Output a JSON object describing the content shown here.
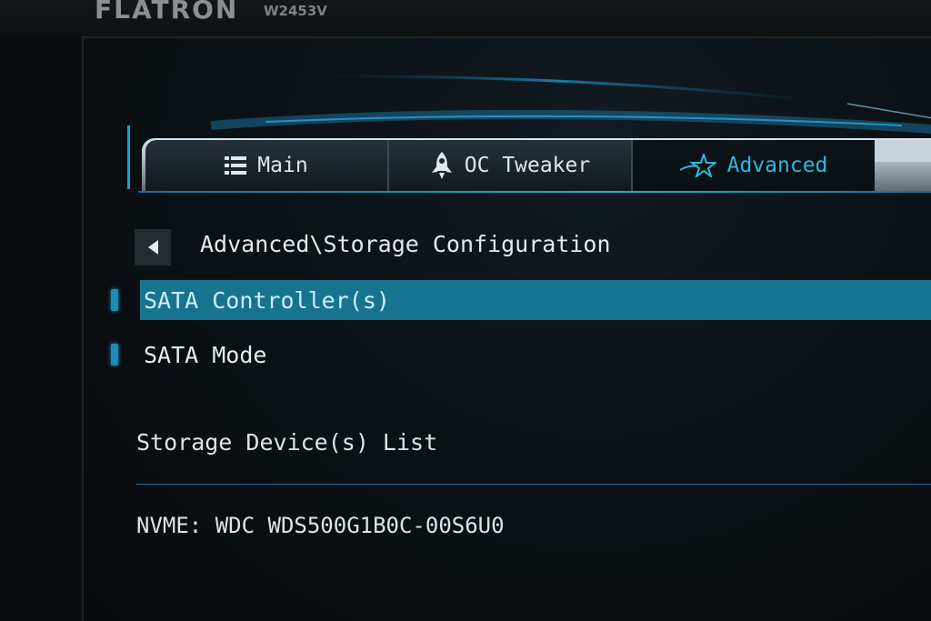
{
  "monitor": {
    "brand": "FLATRON",
    "model": "W2453V"
  },
  "tabs": [
    {
      "label": "Main",
      "icon": "list-icon",
      "active": false
    },
    {
      "label": "OC Tweaker",
      "icon": "rocket-icon",
      "active": false
    },
    {
      "label": "Advanced",
      "icon": "star-icon",
      "active": true
    }
  ],
  "breadcrumb": "Advanced\\Storage Configuration",
  "menu_items": [
    {
      "label": "SATA Controller(s)",
      "selected": true
    },
    {
      "label": "SATA Mode",
      "selected": false
    }
  ],
  "storage_section": {
    "title": "Storage Device(s) List",
    "devices": [
      "NVME: WDC WDS500G1B0C-00S6U0"
    ]
  },
  "colors": {
    "accent": "#2fb6e0",
    "selection": "#17748f",
    "background": "#0b1115"
  }
}
